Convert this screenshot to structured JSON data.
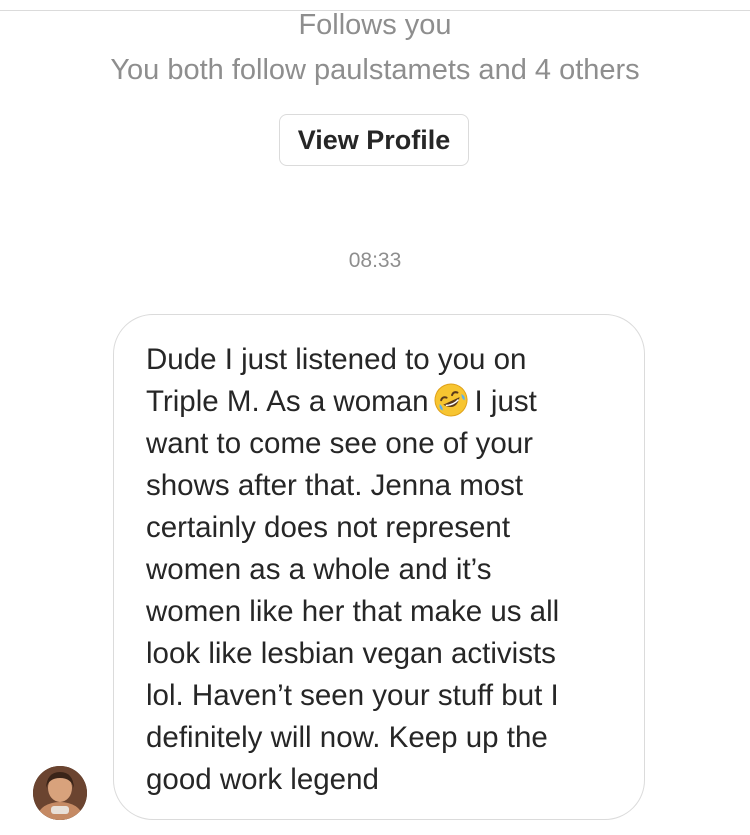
{
  "profile_header": {
    "follows_you": "Follows you",
    "mutual_followers": "You both follow paulstamets and 4 others",
    "view_profile_label": "View Profile"
  },
  "thread": {
    "timestamp": "08:33",
    "message": {
      "text_before_emoji": "Dude I just listened to you on\nTriple M. As a woman",
      "emoji": "rolling-on-floor-laughing-emoji",
      "text_after_emoji": "I just\nwant to come see one of your\nshows after that. Jenna most\ncertainly does not represent\nwomen as a whole and it’s\nwomen like her that make us all\nlook like lesbian vegan activists\nlol. Haven’t seen your stuff but I\ndefinitely will now. Keep up the\ngood work legend"
    },
    "sender_avatar": "avatar"
  },
  "colors": {
    "secondary_text": "#8e8e8e",
    "primary_text": "#262626",
    "border": "#dbdbdb",
    "background": "#ffffff"
  }
}
